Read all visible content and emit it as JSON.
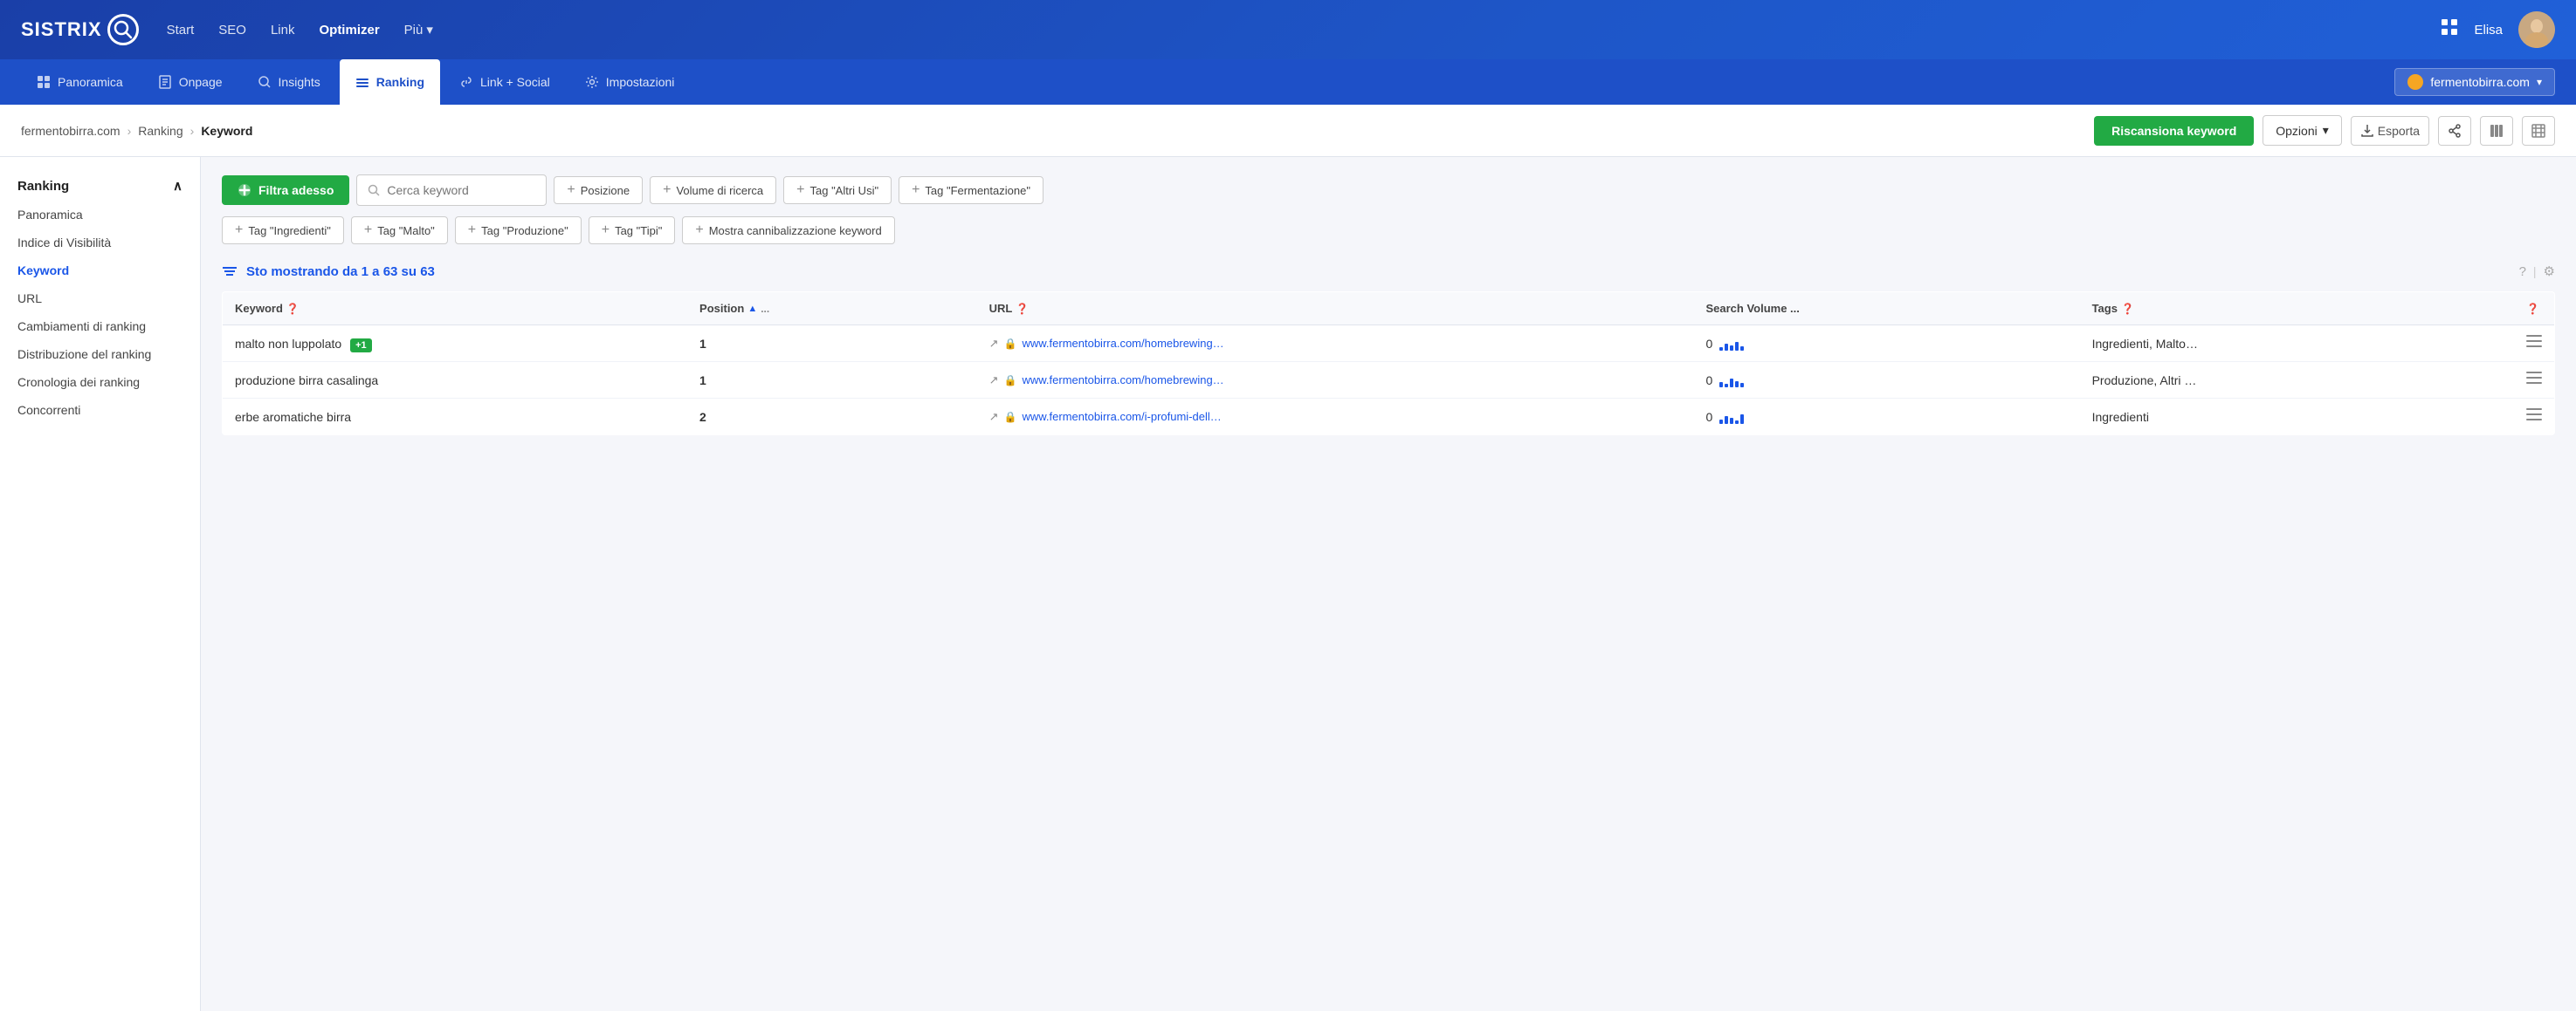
{
  "brand": {
    "name": "SISTRIX",
    "logo_symbol": "🔍"
  },
  "top_nav": {
    "links": [
      {
        "label": "Start",
        "active": false
      },
      {
        "label": "SEO",
        "active": false
      },
      {
        "label": "Link",
        "active": false
      },
      {
        "label": "Optimizer",
        "active": true
      },
      {
        "label": "Più",
        "active": false,
        "has_dropdown": true
      }
    ],
    "user_name": "Elisa",
    "grid_icon": "⊞"
  },
  "sub_nav": {
    "items": [
      {
        "label": "Panoramica",
        "icon": "📦",
        "active": false
      },
      {
        "label": "Onpage",
        "icon": "🖥",
        "active": false
      },
      {
        "label": "Insights",
        "icon": "🔍",
        "active": false
      },
      {
        "label": "Ranking",
        "icon": "≡",
        "active": true
      },
      {
        "label": "Link + Social",
        "icon": "🔗",
        "active": false
      },
      {
        "label": "Impostazioni",
        "icon": "⚙",
        "active": false
      }
    ],
    "domain": "fermentobirra.com",
    "domain_icon": "🟡",
    "dropdown_arrow": "▾"
  },
  "breadcrumb": {
    "items": [
      {
        "label": "fermentobirra.com",
        "is_link": true
      },
      {
        "label": "Ranking",
        "is_link": true
      },
      {
        "label": "Keyword",
        "is_current": true
      }
    ],
    "separator": "›"
  },
  "actions": {
    "rescan": "Riscansiona keyword",
    "options": "Opzioni",
    "export": "Esporta",
    "share_icon": "⤢",
    "col_icon": "⊞",
    "settings_icon": "⚙"
  },
  "sidebar": {
    "section_title": "Ranking",
    "collapse_icon": "∧",
    "items": [
      {
        "label": "Panoramica",
        "active": false
      },
      {
        "label": "Indice di Visibilità",
        "active": false
      },
      {
        "label": "Keyword",
        "active": true
      },
      {
        "label": "URL",
        "active": false
      },
      {
        "label": "Cambiamenti di ranking",
        "active": false
      },
      {
        "label": "Distribuzione del ranking",
        "active": false
      },
      {
        "label": "Cronologia dei ranking",
        "active": false
      },
      {
        "label": "Concorrenti",
        "active": false
      }
    ]
  },
  "filters": {
    "main_btn": "Filtra adesso",
    "search_placeholder": "Cerca keyword",
    "filter_btns": [
      {
        "label": "Posizione"
      },
      {
        "label": "Volume di ricerca"
      },
      {
        "label": "Tag \"Altri Usi\""
      },
      {
        "label": "Tag \"Fermentazione\""
      },
      {
        "label": "Tag \"Ingredienti\""
      },
      {
        "label": "Tag \"Malto\""
      },
      {
        "label": "Tag \"Produzione\""
      },
      {
        "label": "Tag \"Tipi\""
      },
      {
        "label": "Mostra cannibalizzazione keyword"
      }
    ]
  },
  "results": {
    "showing_text": "Sto mostrando da 1 a 63 su 63",
    "help_icon": "?",
    "settings_icon": "⚙"
  },
  "table": {
    "columns": [
      {
        "label": "Keyword",
        "has_help": true
      },
      {
        "label": "Position",
        "sort_arrow": "▲",
        "extra": "...",
        "has_help": false
      },
      {
        "label": "URL",
        "has_help": true
      },
      {
        "label": "Search Volume ...",
        "has_help": false
      },
      {
        "label": "Tags",
        "has_help": true
      },
      {
        "label": "",
        "has_help": true
      }
    ],
    "rows": [
      {
        "keyword": "malto non luppolato",
        "position": "1",
        "badge": "+1",
        "url_icon": "↗",
        "lock": "🔒",
        "url_base": "www.fermentobirra.com",
        "url_path": "/homebrewing…",
        "search_vol": "0",
        "tags": "Ingredienti, Malto…",
        "menu": "≡"
      },
      {
        "keyword": "produzione birra casalinga",
        "position": "1",
        "badge": null,
        "url_icon": "↗",
        "lock": "🔒",
        "url_base": "www.fermentobirra.com",
        "url_path": "/homebrewing…",
        "search_vol": "0",
        "tags": "Produzione, Altri …",
        "menu": "≡"
      },
      {
        "keyword": "erbe aromatiche birra",
        "position": "2",
        "badge": null,
        "url_icon": "↗",
        "lock": "🔒",
        "url_base": "www.fermentobirra.com",
        "url_path": "/i-profumi-dell…",
        "search_vol": "0",
        "tags": "Ingredienti",
        "menu": "≡"
      }
    ]
  },
  "colors": {
    "brand_blue": "#1a3fa8",
    "green": "#22aa44",
    "link_blue": "#1a56e8"
  }
}
